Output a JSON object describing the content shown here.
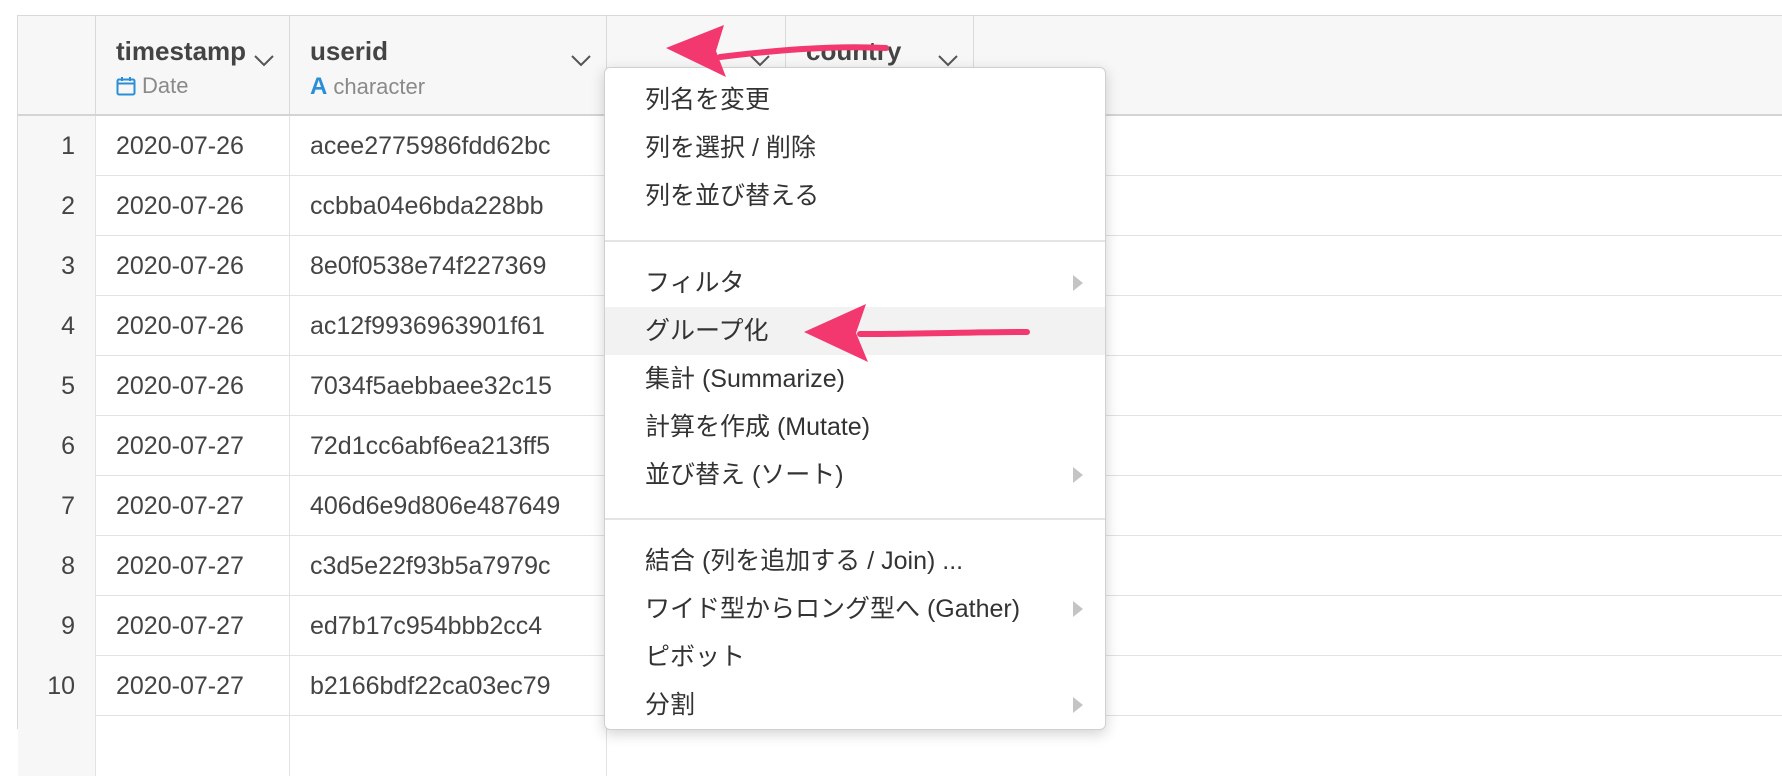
{
  "columns": {
    "timestamp": {
      "name": "timestamp",
      "type": "Date"
    },
    "userid": {
      "name": "userid",
      "type": "character"
    },
    "country": {
      "name": "country"
    }
  },
  "rows": [
    {
      "num": "1",
      "timestamp": "2020-07-26",
      "userid": "acee2775986fdd62bc"
    },
    {
      "num": "2",
      "timestamp": "2020-07-26",
      "userid": "ccbba04e6bda228bb"
    },
    {
      "num": "3",
      "timestamp": "2020-07-26",
      "userid": "8e0f0538e74f227369"
    },
    {
      "num": "4",
      "timestamp": "2020-07-26",
      "userid": "ac12f9936963901f61"
    },
    {
      "num": "5",
      "timestamp": "2020-07-26",
      "userid": "7034f5aebbaee32c15"
    },
    {
      "num": "6",
      "timestamp": "2020-07-27",
      "userid": "72d1cc6abf6ea213ff5"
    },
    {
      "num": "7",
      "timestamp": "2020-07-27",
      "userid": "406d6e9d806e487649"
    },
    {
      "num": "8",
      "timestamp": "2020-07-27",
      "userid": "c3d5e22f93b5a7979c"
    },
    {
      "num": "9",
      "timestamp": "2020-07-27",
      "userid": "ed7b17c954bbb2cc4"
    },
    {
      "num": "10",
      "timestamp": "2020-07-27",
      "userid": "b2166bdf22ca03ec79"
    }
  ],
  "menu": {
    "rename": "列名を変更",
    "select_delete": "列を選択 / 削除",
    "reorder": "列を並び替える",
    "filter": "フィルタ",
    "group_by": "グループ化",
    "summarize": "集計 (Summarize)",
    "mutate": "計算を作成 (Mutate)",
    "sort": "並び替え (ソート)",
    "join": "結合 (列を追加する / Join) ...",
    "gather": "ワイド型からロング型へ (Gather)",
    "pivot": "ピボット",
    "split": "分割"
  },
  "colors": {
    "accent_arrow": "#f2386f",
    "type_icon_blue": "#2a8fd6"
  }
}
